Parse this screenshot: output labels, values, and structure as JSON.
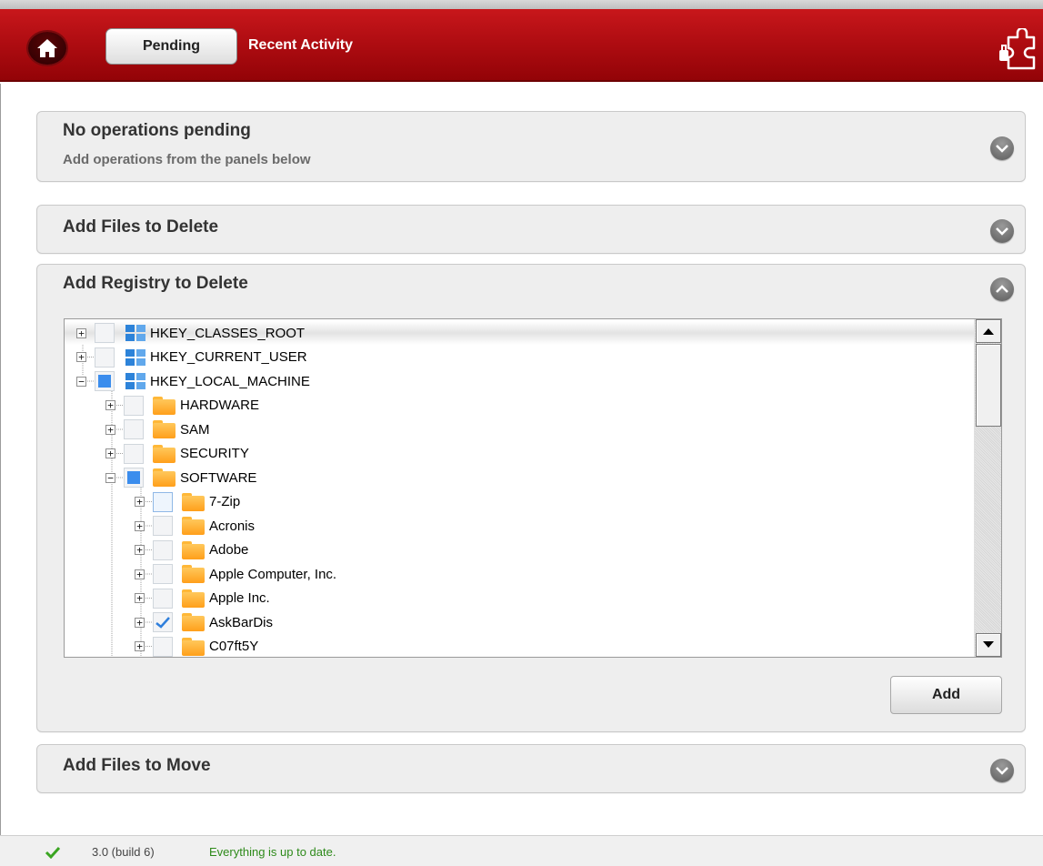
{
  "header": {
    "tabs": [
      "Pending",
      "Recent Activity"
    ],
    "icons": {
      "home": "home-icon",
      "logo": "puzzle-shield-icon"
    },
    "accent_color": "#b00d12"
  },
  "panels": {
    "pending": {
      "title": "No operations pending",
      "subtitle": "Add operations from the panels below",
      "state": "collapsed"
    },
    "files": {
      "title": "Add Files to Delete",
      "state": "collapsed"
    },
    "registry": {
      "title": "Add Registry to Delete",
      "state": "expanded",
      "add_label": "Add"
    },
    "move": {
      "title": "Add Files to Move",
      "state": "collapsed"
    }
  },
  "tree": {
    "rows": [
      {
        "label": "HKEY_CLASSES_ROOT",
        "depth": 0,
        "icon": "hive",
        "expander": "+",
        "check": "none",
        "selected": true
      },
      {
        "label": "HKEY_CURRENT_USER",
        "depth": 0,
        "icon": "hive",
        "expander": "+",
        "check": "none"
      },
      {
        "label": "HKEY_LOCAL_MACHINE",
        "depth": 0,
        "icon": "hive",
        "expander": "-",
        "check": "partial"
      },
      {
        "label": "HARDWARE",
        "depth": 1,
        "icon": "folder",
        "expander": "+",
        "check": "none"
      },
      {
        "label": "SAM",
        "depth": 1,
        "icon": "folder",
        "expander": "+",
        "check": "none"
      },
      {
        "label": "SECURITY",
        "depth": 1,
        "icon": "folder",
        "expander": "+",
        "check": "none"
      },
      {
        "label": "SOFTWARE",
        "depth": 1,
        "icon": "folder",
        "expander": "-",
        "check": "partial"
      },
      {
        "label": "7-Zip",
        "depth": 2,
        "icon": "folder",
        "expander": "+",
        "check": "hover"
      },
      {
        "label": "Acronis",
        "depth": 2,
        "icon": "folder",
        "expander": "+",
        "check": "none"
      },
      {
        "label": "Adobe",
        "depth": 2,
        "icon": "folder",
        "expander": "+",
        "check": "none"
      },
      {
        "label": "Apple Computer, Inc.",
        "depth": 2,
        "icon": "folder",
        "expander": "+",
        "check": "none"
      },
      {
        "label": "Apple Inc.",
        "depth": 2,
        "icon": "folder",
        "expander": "+",
        "check": "none"
      },
      {
        "label": "AskBarDis",
        "depth": 2,
        "icon": "folder",
        "expander": "+",
        "check": "checked"
      },
      {
        "label": "C07ft5Y",
        "depth": 2,
        "icon": "folder",
        "expander": "+",
        "check": "none"
      }
    ],
    "scroll_position": 0
  },
  "status": {
    "version": "3.0 (build 6)",
    "message": "Everything is up to date.",
    "icon": "check-icon",
    "ok_color": "#2e8a1a"
  }
}
